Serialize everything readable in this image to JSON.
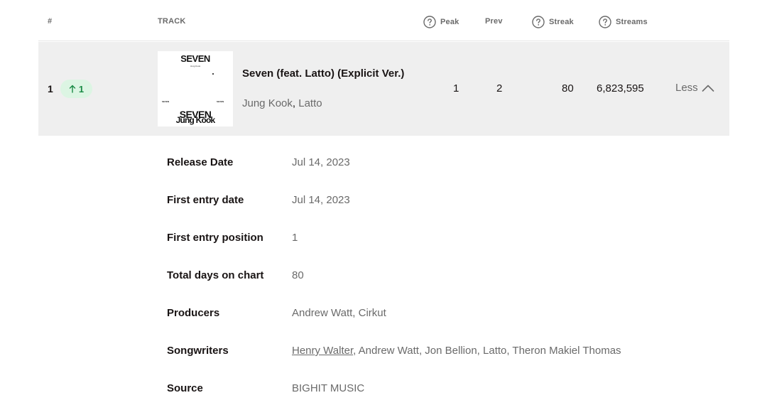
{
  "header": {
    "rank": "#",
    "track": "TRACK",
    "peak": "Peak",
    "prev": "Prev",
    "streak": "Streak",
    "streams": "Streams",
    "help_icon": "question-circle-icon"
  },
  "track": {
    "rank": "1",
    "movement": "1",
    "movement_icon": "arrow-up-icon",
    "movement_color": "#1a8a45",
    "title": "Seven (feat. Latto) (Explicit Ver.)",
    "artists": [
      "Jung Kook",
      "Latto"
    ],
    "peak": "1",
    "prev": "2",
    "streak": "80",
    "streams": "6,823,595",
    "toggle_label": "Less",
    "toggle_icon": "chevron-up-icon",
    "cover": {
      "title": "SEVEN",
      "subtitle": "Jung Kook",
      "small_left": "SEVEN",
      "small_right": "SEVEN",
      "bottom_title": "SEVEN",
      "bottom_artist": "Jung Kook"
    }
  },
  "details": {
    "release_date": {
      "label": "Release Date",
      "value": "Jul 14, 2023"
    },
    "first_entry_date": {
      "label": "First entry date",
      "value": "Jul 14, 2023"
    },
    "first_entry_position": {
      "label": "First entry position",
      "value": "1"
    },
    "total_days": {
      "label": "Total days on chart",
      "value": "80"
    },
    "producers": {
      "label": "Producers",
      "value": "Andrew Watt, Cirkut"
    },
    "songwriters": {
      "label": "Songwriters",
      "linked": "Henry Walter",
      "rest": ", Andrew Watt, Jon Bellion, Latto, Theron Makiel Thomas"
    },
    "source": {
      "label": "Source",
      "value": "BIGHIT MUSIC"
    }
  }
}
